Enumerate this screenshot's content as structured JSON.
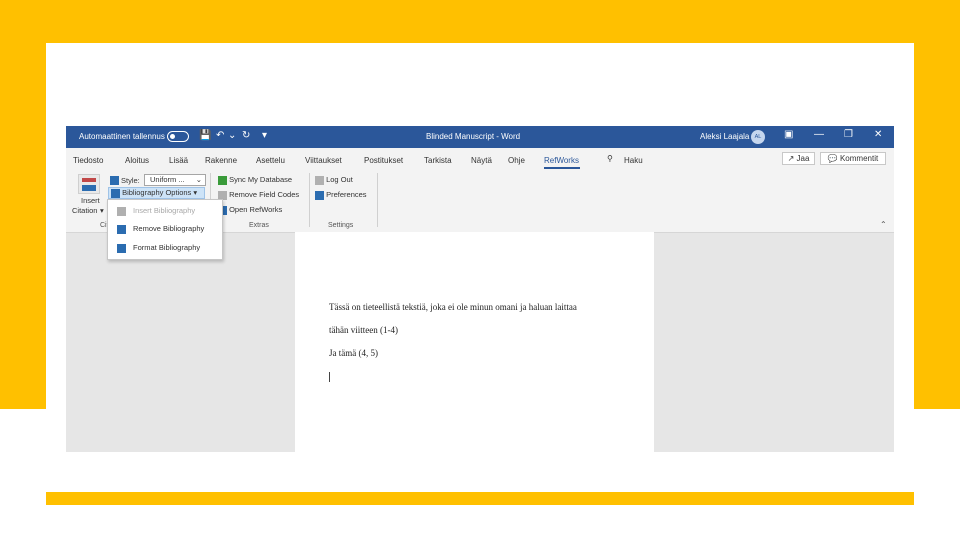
{
  "titlebar": {
    "autosave_label": "Automaattinen tallennus",
    "document_title": "Blinded Manuscript - Word",
    "user_name": "Aleksi Laajala",
    "user_initials": "AL"
  },
  "tabs": [
    "Tiedosto",
    "Aloitus",
    "Lisää",
    "Rakenne",
    "Asettelu",
    "Viittaukset",
    "Postitukset",
    "Tarkista",
    "Näytä",
    "Ohje",
    "RefWorks",
    "Haku"
  ],
  "active_tab": "RefWorks",
  "share_button": "Jaa",
  "comments_button": "Kommentit",
  "ribbon": {
    "insert_citation_line1": "Insert",
    "insert_citation_line2": "Citation",
    "style_label": "Style:",
    "style_value": "Uniform ...",
    "bibliography_options": "Bibliography Options",
    "sync_database": "Sync My Database",
    "remove_field_codes": "Remove Field Codes",
    "open_refworks": "Open RefWorks",
    "log_out": "Log Out",
    "preferences": "Preferences",
    "group_citation_partial": "Cit",
    "group_extras": "Extras",
    "group_settings": "Settings"
  },
  "dropdown": {
    "insert_bibliography": "Insert Bibliography",
    "remove_bibliography": "Remove Bibliography",
    "format_bibliography": "Format Bibliography"
  },
  "document": {
    "line1": "Tässä on tieteellistä tekstiä, joka ei ole minun omani ja haluan laittaa",
    "line2": "tähän viitteen (1-4)",
    "line3": "Ja tämä (4, 5)"
  },
  "colors": {
    "accent_yellow": "#FFC000",
    "word_blue": "#2b579a"
  }
}
